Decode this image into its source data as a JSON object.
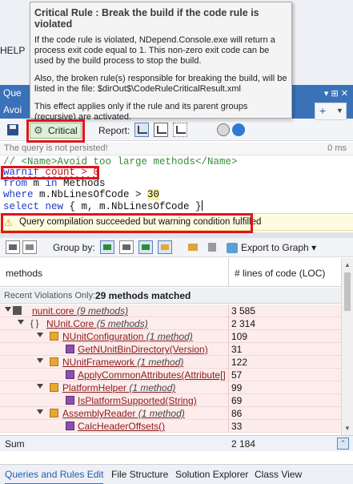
{
  "menu": {
    "help": "HELP"
  },
  "panel": {
    "tab_a": "Que",
    "tab_b": "Avoi",
    "pin": "▾ ⊞ ✕"
  },
  "tooltip": {
    "title": "Critical Rule : Break the build if the code rule is violated",
    "para1": "If the code rule is violated, NDepend.Console.exe will return a process exit code equal to 1. This non-zero exit code can be used by the build process to stop the build.",
    "para2": "Also, the broken rule(s) responsible for breaking the build, will be listed in the file: $dirOut$\\CodeRuleCriticalResult.xml",
    "para3": "This effect applies only if the rule and its parent groups (recursive) are activated."
  },
  "toolbar": {
    "critical_label": "Critical",
    "report_label": "Report:"
  },
  "query": {
    "not_persisted": "The query is not persisted!",
    "elapsed": "0 ms",
    "line1": "// <Name>Avoid too large methods</Name>",
    "line2_kw": "warnif",
    "line2_rest": " count > 0",
    "line3_from": "from",
    "line3_m": " m ",
    "line3_in": "in",
    "line3_methods": " Methods",
    "line4_where": "where",
    "line4_rest": " m.NbLinesOfCode > ",
    "line4_num": "30",
    "line5_select": "select",
    "line5_new": " new",
    "line5_rest": " { m, m.NbLinesOfCode }"
  },
  "status": {
    "message": "Query compilation succeeded but warning condition fulfilled"
  },
  "results_toolbar": {
    "group_by": "Group by:",
    "export": "Export to Graph",
    "export_caret": "▾"
  },
  "grid": {
    "col_methods": "methods",
    "col_loc": "# lines of code (LOC)",
    "recent_label": "Recent Violations Only:",
    "recent_count": "29 methods matched",
    "rows": [
      {
        "name": "nunit.core",
        "note": " (9 methods)",
        "value": "3 585"
      },
      {
        "name": "NUnit.Core",
        "note": " (5 methods)",
        "value": "2 314"
      },
      {
        "name": "NUnitConfiguration",
        "note": " (1 method)",
        "value": "109"
      },
      {
        "name": "GetNUnitBinDirectory(Version)",
        "note": "",
        "value": "31"
      },
      {
        "name": "NUnitFramework",
        "note": " (1 method)",
        "value": "122"
      },
      {
        "name": "ApplyCommonAttributes(Attribute[],Tes",
        "note": "",
        "value": "57"
      },
      {
        "name": "PlatformHelper",
        "note": " (1 method)",
        "value": "99"
      },
      {
        "name": "IsPlatformSupported(String)",
        "note": "",
        "value": "69"
      },
      {
        "name": "AssemblyReader",
        "note": " (1 method)",
        "value": "86"
      },
      {
        "name": "CalcHeaderOffsets()",
        "note": "",
        "value": "33"
      }
    ],
    "sum_label": "Sum",
    "sum_value": "2 184"
  },
  "bottom_tabs": [
    "Queries and Rules Edit",
    "File Structure",
    "Solution Explorer",
    "Class View"
  ],
  "colors": {
    "highlight": "#e0141d",
    "accent": "#3a72b8",
    "violation_row": "#fdecec"
  }
}
